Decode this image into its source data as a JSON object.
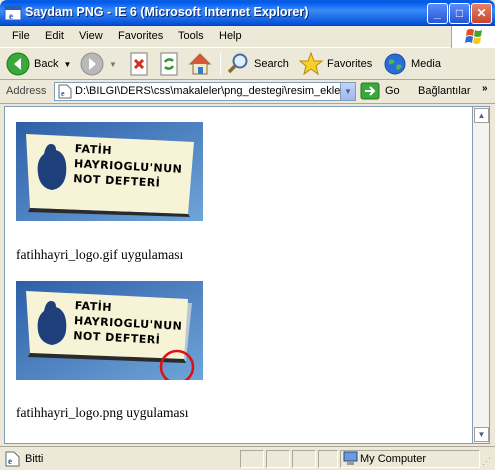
{
  "window": {
    "title": "Saydam PNG - IE 6 (Microsoft Internet Explorer)",
    "min_label": "_",
    "max_label": "□",
    "close_label": "✕"
  },
  "menu": {
    "items": [
      "File",
      "Edit",
      "View",
      "Favorites",
      "Tools",
      "Help"
    ]
  },
  "toolbar": {
    "back_label": "Back",
    "search_label": "Search",
    "favorites_label": "Favorites",
    "media_label": "Media"
  },
  "address": {
    "label": "Address",
    "value": "D:\\BILGI\\DERS\\css\\makaleler\\png_destegi\\resim_ekle.ht",
    "go_label": "Go",
    "links_label": "Bağlantılar"
  },
  "page": {
    "logo_line1": "FATİH",
    "logo_line2": "HAYRIOGLU'NUN",
    "logo_line3": "NOT DEFTERİ",
    "gif_caption": "fatihhayri_logo.gif uygulaması",
    "png_caption": "fatihhayri_logo.png uygulaması"
  },
  "status": {
    "text": "Bitti",
    "zone": "My Computer"
  },
  "colors": {
    "titlebar": "#0058EE",
    "logo_bg": "#4B86C4",
    "paper": "#F7F3D6",
    "highlight_circle": "#E01010"
  }
}
